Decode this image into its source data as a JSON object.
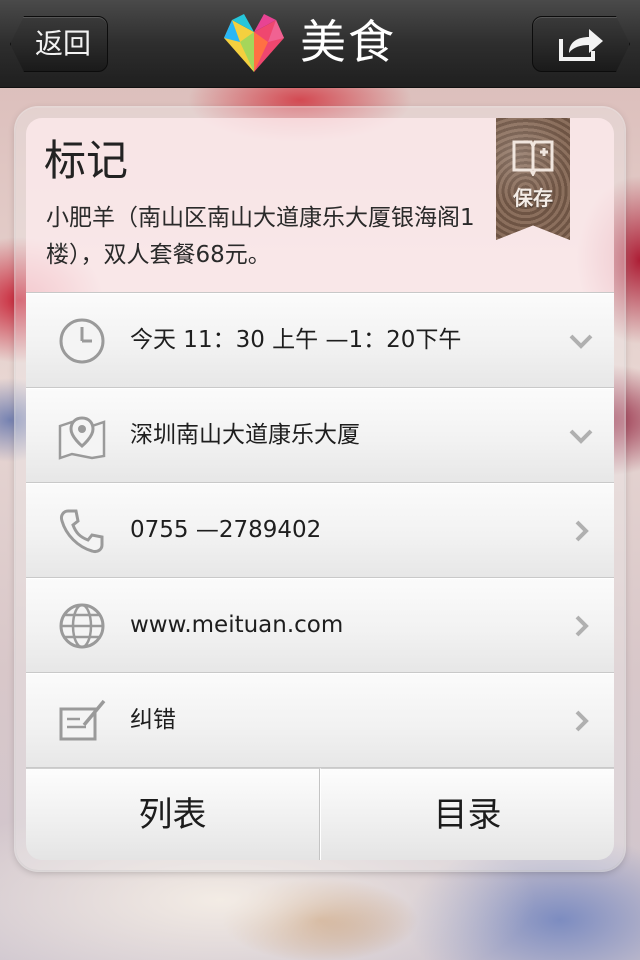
{
  "navbar": {
    "back_label": "返回",
    "brand": "美食",
    "share_icon": "share-icon"
  },
  "card": {
    "title": "标记",
    "description": "小肥羊（南山区南山大道康乐大厦银海阁1楼），双人套餐68元。",
    "save_label": "保存",
    "rows": [
      {
        "icon": "clock-icon",
        "text": "今天   11：30 上午 —1：20下午",
        "chevron": "chevron-down-icon"
      },
      {
        "icon": "map-pin-icon",
        "text": "深圳南山大道康乐大厦",
        "chevron": "chevron-down-icon"
      },
      {
        "icon": "phone-icon",
        "text": "0755 —2789402",
        "chevron": "chevron-right-icon"
      },
      {
        "icon": "globe-icon",
        "text": "www.meituan.com",
        "chevron": "chevron-right-icon"
      },
      {
        "icon": "edit-icon",
        "text": "纠错",
        "chevron": "chevron-right-icon"
      }
    ],
    "footer": {
      "list_label": "列表",
      "catalog_label": "目录"
    }
  },
  "colors": {
    "navbar": "#2e2e2e",
    "text": "#1e1e1e",
    "ribbon": "#7a5f4e"
  }
}
